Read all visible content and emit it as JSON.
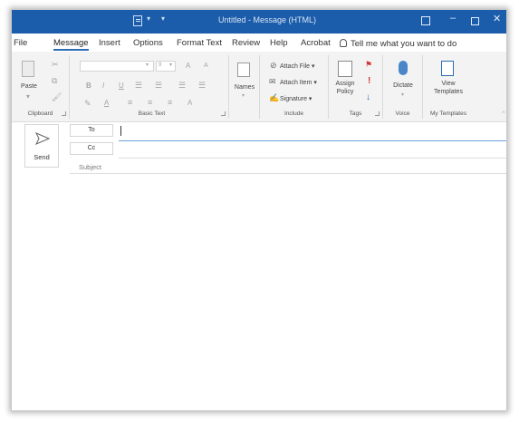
{
  "window": {
    "title": "Untitled  -  Message (HTML)"
  },
  "menu": {
    "file": "File",
    "message": "Message",
    "insert": "Insert",
    "options": "Options",
    "format_text": "Format Text",
    "review": "Review",
    "help": "Help",
    "acrobat": "Acrobat",
    "tell_me": "Tell me what you want to do"
  },
  "ribbon": {
    "clipboard": {
      "paste": "Paste",
      "label": "Clipboard"
    },
    "basic_text": {
      "font_size_arrow": "9",
      "bold": "B",
      "italic": "I",
      "underline": "U",
      "grow": "A",
      "shrink": "A",
      "label": "Basic Text"
    },
    "names": {
      "label": "Names"
    },
    "include": {
      "attach_file": "Attach File",
      "attach_item": "Attach Item",
      "signature": "Signature",
      "label": "Include"
    },
    "tags": {
      "assign_policy_line1": "Assign",
      "assign_policy_line2": "Policy",
      "label": "Tags"
    },
    "voice": {
      "dictate": "Dictate",
      "label": "Voice"
    },
    "templates": {
      "view_line1": "View",
      "view_line2": "Templates",
      "label": "My Templates"
    }
  },
  "compose": {
    "send": "Send",
    "to": "To",
    "cc": "Cc",
    "subject": "Subject"
  },
  "colors": {
    "titlebar": "#1b5dab",
    "accent": "#2b6cb5",
    "flag_red": "#d13438",
    "arrow_blue": "#2b6cb5"
  }
}
